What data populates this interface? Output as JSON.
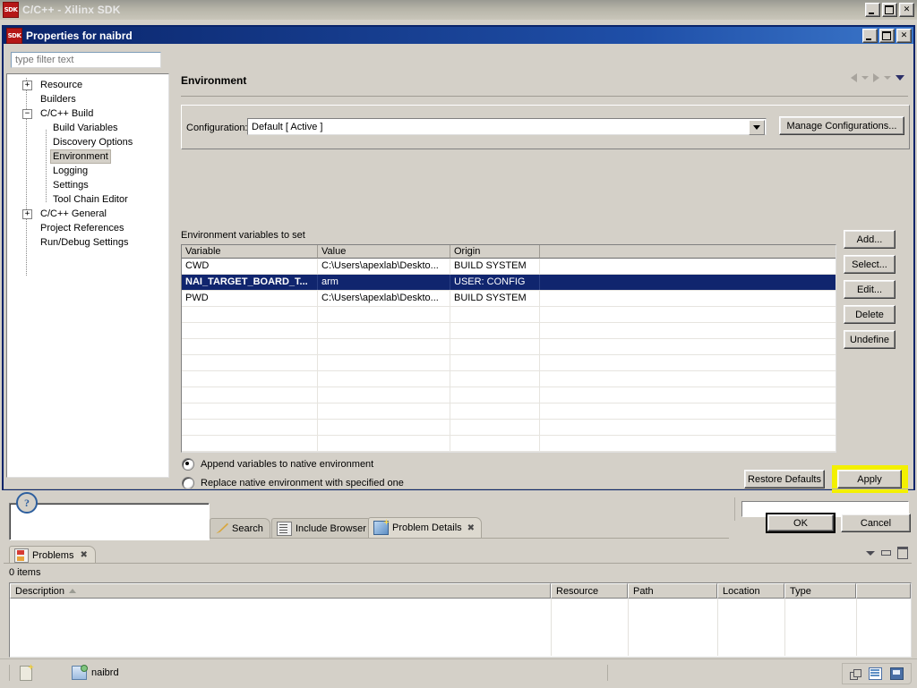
{
  "app_window": {
    "title": "C/C++ - Xilinx SDK",
    "icon": "sdk-icon",
    "minimize_label": "",
    "maximize_label": "",
    "close_label": "✕"
  },
  "dialog": {
    "title": "Properties for naibrd",
    "icon": "sdk-icon",
    "filter": {
      "placeholder": "type filter text",
      "value": ""
    },
    "tree": [
      {
        "label": "Resource",
        "level": 0,
        "expander": "+",
        "selected": false
      },
      {
        "label": "Builders",
        "level": 0,
        "expander": "",
        "selected": false
      },
      {
        "label": "C/C++ Build",
        "level": 0,
        "expander": "-",
        "selected": false
      },
      {
        "label": "Build Variables",
        "level": 1,
        "expander": "",
        "selected": false
      },
      {
        "label": "Discovery Options",
        "level": 1,
        "expander": "",
        "selected": false
      },
      {
        "label": "Environment",
        "level": 1,
        "expander": "",
        "selected": true
      },
      {
        "label": "Logging",
        "level": 1,
        "expander": "",
        "selected": false
      },
      {
        "label": "Settings",
        "level": 1,
        "expander": "",
        "selected": false
      },
      {
        "label": "Tool Chain Editor",
        "level": 1,
        "expander": "",
        "selected": false
      },
      {
        "label": "C/C++ General",
        "level": 0,
        "expander": "+",
        "selected": false
      },
      {
        "label": "Project References",
        "level": 0,
        "expander": "",
        "selected": false
      },
      {
        "label": "Run/Debug Settings",
        "level": 0,
        "expander": "",
        "selected": false
      }
    ],
    "page": {
      "title": "Environment",
      "nav": {
        "back_icon": "arrow-left-icon",
        "back_menu_icon": "chevron-down-icon",
        "forward_icon": "arrow-right-icon",
        "forward_menu_icon": "chevron-down-icon",
        "menu_icon": "chevron-down-icon"
      },
      "configuration": {
        "label": "Configuration:",
        "value": "Default  [ Active ]",
        "dropdown_icon": "chevron-down-icon",
        "manage_button": "Manage Configurations..."
      },
      "env_section": {
        "label": "Environment variables to set",
        "columns": [
          "Variable",
          "Value",
          "Origin",
          ""
        ],
        "rows": [
          {
            "variable": "CWD",
            "value": "C:\\Users\\apexlab\\Deskto...",
            "origin": "BUILD SYSTEM",
            "selected": false
          },
          {
            "variable": "NAI_TARGET_BOARD_T...",
            "value": "arm",
            "origin": "USER: CONFIG",
            "selected": true
          },
          {
            "variable": "PWD",
            "value": "C:\\Users\\apexlab\\Deskto...",
            "origin": "BUILD SYSTEM",
            "selected": false
          }
        ],
        "empty_row_count": 11,
        "buttons": [
          "Add...",
          "Select...",
          "Edit...",
          "Delete",
          "Undefine"
        ]
      },
      "radios": [
        {
          "label": "Append variables to native environment",
          "checked": true
        },
        {
          "label": "Replace native environment with specified one",
          "checked": false
        }
      ],
      "restore_defaults_label": "Restore Defaults",
      "apply_label": "Apply",
      "apply_highlight_color": "#f3f000"
    },
    "footer": {
      "help_icon": "help-icon",
      "help_glyph": "?",
      "ok_label": "OK",
      "cancel_label": "Cancel"
    }
  },
  "background": {
    "view_tabs": [
      {
        "label": "Search",
        "icon": "search-icon",
        "active": false,
        "closable": false
      },
      {
        "label": "Include Browser",
        "icon": "include-browser-icon",
        "active": false,
        "closable": false
      },
      {
        "label": "Problem Details",
        "icon": "problem-details-icon",
        "active": true,
        "closable": true,
        "close_glyph": "✖"
      }
    ],
    "problems_view": {
      "tab_label": "Problems",
      "tab_icon": "problems-icon",
      "close_glyph": "✖",
      "count_text": "0 items",
      "columns": [
        "Description",
        "Resource",
        "Path",
        "Location",
        "Type"
      ],
      "sort_column": "Description",
      "sort_icon": "sort-ascending-icon",
      "rows": [],
      "toolbar": {
        "view_menu_icon": "view-menu-icon",
        "minimize_icon": "minimize-icon",
        "maximize_icon": "maximize-icon"
      }
    },
    "right_pane_toolbar": {
      "minimize_icon": "minimize-icon",
      "maximize_icon": "maximize-icon"
    },
    "status_bar": {
      "edit_icon": "writable-icon",
      "project_label": "naibrd",
      "project_icon": "project-icon",
      "right_icons": [
        "tile-icon",
        "list-icon",
        "monitor-icon"
      ]
    }
  }
}
